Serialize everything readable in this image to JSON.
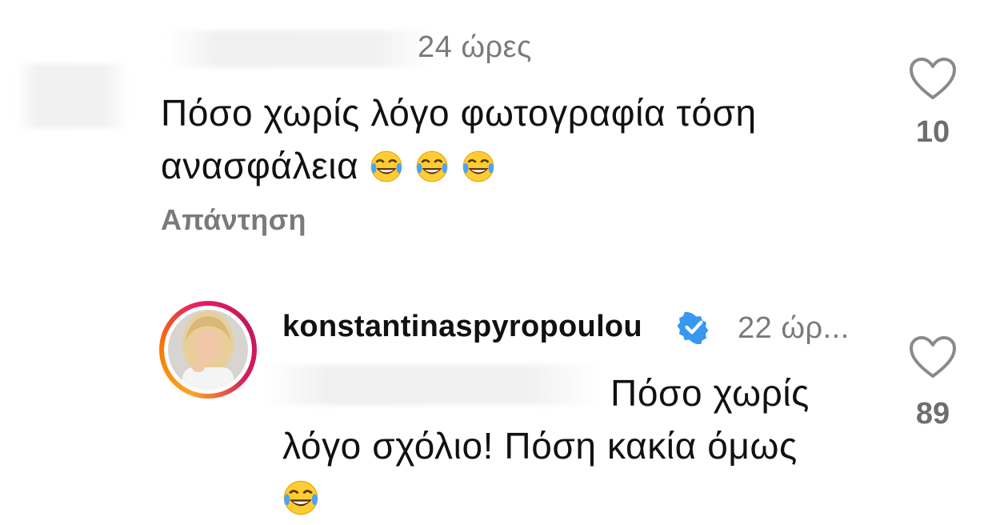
{
  "comments": [
    {
      "time": "24 ώρες",
      "text_line1": "Πόσο χωρίς λόγο φωτογραφία τόση",
      "text_line2": "ανασφάλεια",
      "emoji_count": 3,
      "reply_label": "Απάντηση",
      "likes": "10"
    },
    {
      "username": "konstantinaspyropoulou",
      "verified": true,
      "time": "22 ώρ...",
      "text_line1": "Πόσο χωρίς",
      "text_line2": "λόγο σχόλιο! Πόση κακία όμως",
      "emoji_count": 1,
      "likes": "89"
    }
  ],
  "colors": {
    "text": "#111111",
    "secondary": "#7a7a7a",
    "verified_blue": "#3897f0"
  }
}
